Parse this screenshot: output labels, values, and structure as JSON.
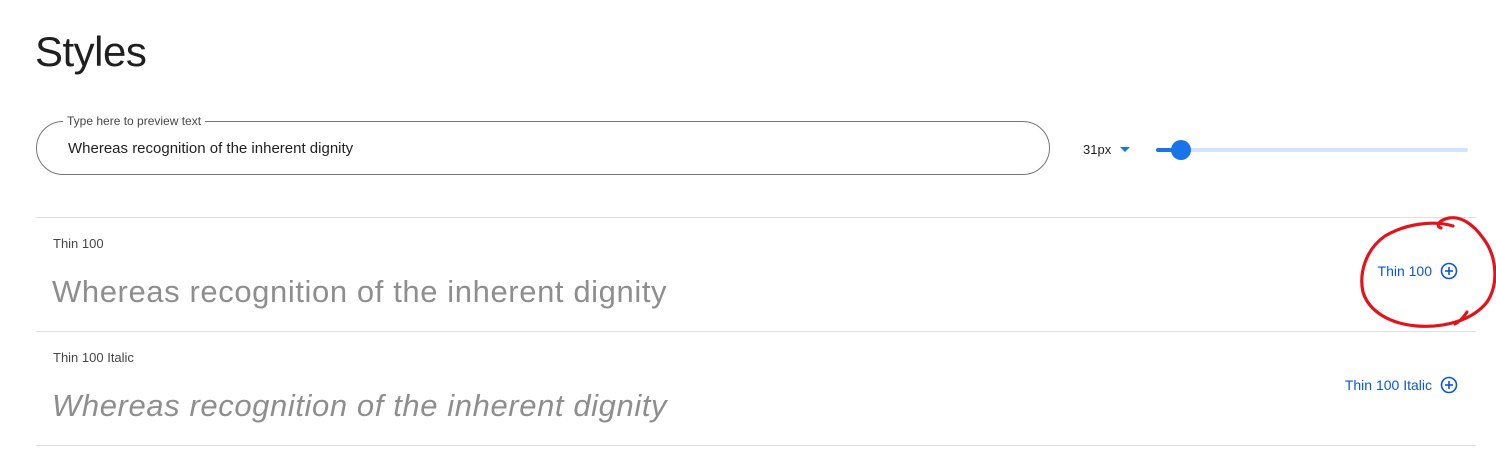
{
  "page": {
    "title": "Styles"
  },
  "preview": {
    "label": "Type here to preview text",
    "value": "Whereas recognition of the inherent dignity"
  },
  "size": {
    "value": "31px",
    "slider_fraction": 0.08
  },
  "styles": [
    {
      "name": "Thin 100",
      "preview_text": "Whereas recognition of the inherent dignity",
      "action_label": "Thin 100",
      "italic": false
    },
    {
      "name": "Thin 100 Italic",
      "preview_text": "Whereas recognition of the inherent dignity",
      "action_label": "Thin 100 Italic",
      "italic": true
    }
  ],
  "icons": {
    "add": "add-circle-icon",
    "dropdown": "caret-down-icon"
  },
  "colors": {
    "accent": "#1a73e8",
    "link": "#0b57d0",
    "annotation": "#e3131b",
    "preview_text": "#8e8e8e"
  }
}
